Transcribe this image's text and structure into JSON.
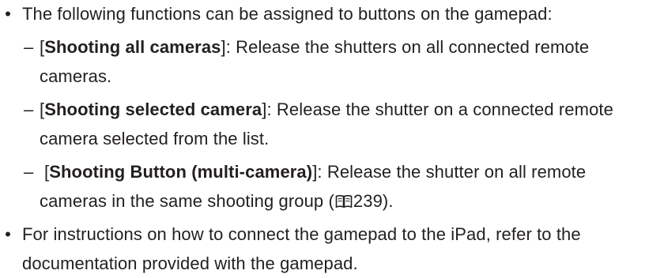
{
  "bullets": [
    {
      "marker": "•",
      "lines": [
        "The following functions can be assigned to buttons on the gamepad:"
      ],
      "sub_items": [
        {
          "marker": "–",
          "open_bracket": "[",
          "term": "Shooting all cameras",
          "close_bracket": "]",
          "desc_line1": ": Release the shutters on  all connected remote",
          "desc_line2": "cameras."
        },
        {
          "marker": "–",
          "open_bracket": "[",
          "term": "Shooting selected camera",
          "close_bracket": "]",
          "desc_line1": ": Release the shutter on a connected remote",
          "desc_line2": "camera selected from the list."
        },
        {
          "marker": "–",
          "open_bracket": "[",
          "term": "Shooting Button (multi-camera)",
          "close_bracket": "]",
          "desc_line1": ": Release the shutter on all remote",
          "desc_line2_before": "cameras in the same shooting group (",
          "page_ref": "239",
          "desc_line2_after": ")."
        }
      ]
    },
    {
      "marker": "•",
      "lines": [
        "For instructions on how to connect the gamepad to the iPad, refer to the",
        "documentation provided with the gamepad."
      ]
    }
  ],
  "icons": {
    "page_reference": "book-icon"
  }
}
